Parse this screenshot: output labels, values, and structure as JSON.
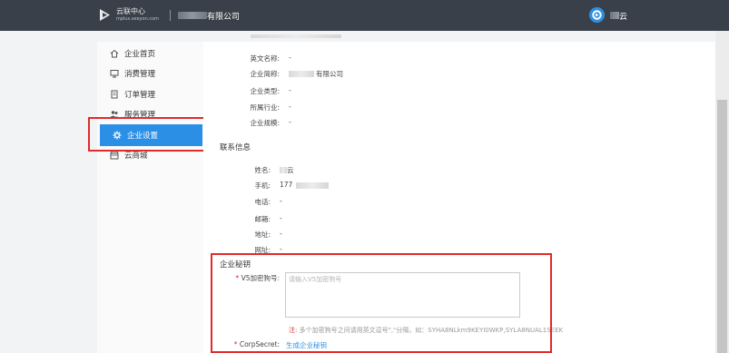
{
  "header": {
    "logo_title": "云联中心",
    "logo_subtitle": "mplus.seeyon.com",
    "company_name": "有限公司",
    "user_name": "云"
  },
  "sidebar": {
    "items": [
      {
        "label": "企业首页",
        "icon": "home-icon"
      },
      {
        "label": "消费管理",
        "icon": "monitor-icon"
      },
      {
        "label": "订单管理",
        "icon": "document-icon"
      },
      {
        "label": "服务管理",
        "icon": "people-icon"
      },
      {
        "label": "企业设置",
        "icon": "gear-icon",
        "active": true
      },
      {
        "label": "云商城",
        "icon": "store-icon"
      }
    ]
  },
  "company_info": {
    "english_name": {
      "label": "英文名称:",
      "value": "-"
    },
    "short_name": {
      "label": "企业简称:",
      "value": "有限公司"
    },
    "type": {
      "label": "企业类型:",
      "value": "-"
    },
    "industry": {
      "label": "所属行业:",
      "value": "-"
    },
    "scale": {
      "label": "企业规模:",
      "value": "-"
    }
  },
  "contact": {
    "title": "联系信息",
    "name": {
      "label": "姓名:",
      "value": "云"
    },
    "mobile": {
      "label": "手机:",
      "value": "177"
    },
    "phone": {
      "label": "电话:",
      "value": "-"
    },
    "email": {
      "label": "邮箱:",
      "value": "-"
    },
    "address": {
      "label": "地址:",
      "value": "-"
    },
    "website": {
      "label": "网址:",
      "value": "-"
    }
  },
  "secret": {
    "title": "企业秘钥",
    "v5_label": "V5加密狗号:",
    "v5_placeholder": "请输入V5加密狗号",
    "note_prefix": "注:",
    "note_text": "多个加密狗号之间请用英文逗号\",\"分隔，如：SYHA8NLkm9KEYI0WKP,SYLA8NUAL1SEEK",
    "corp_secret_label": "CorpSecret:",
    "generate_link": "生成企业秘钥"
  },
  "colors": {
    "accent": "#2b8fe6",
    "highlight_border": "#e02b2b",
    "topbar": "#3a4049"
  }
}
